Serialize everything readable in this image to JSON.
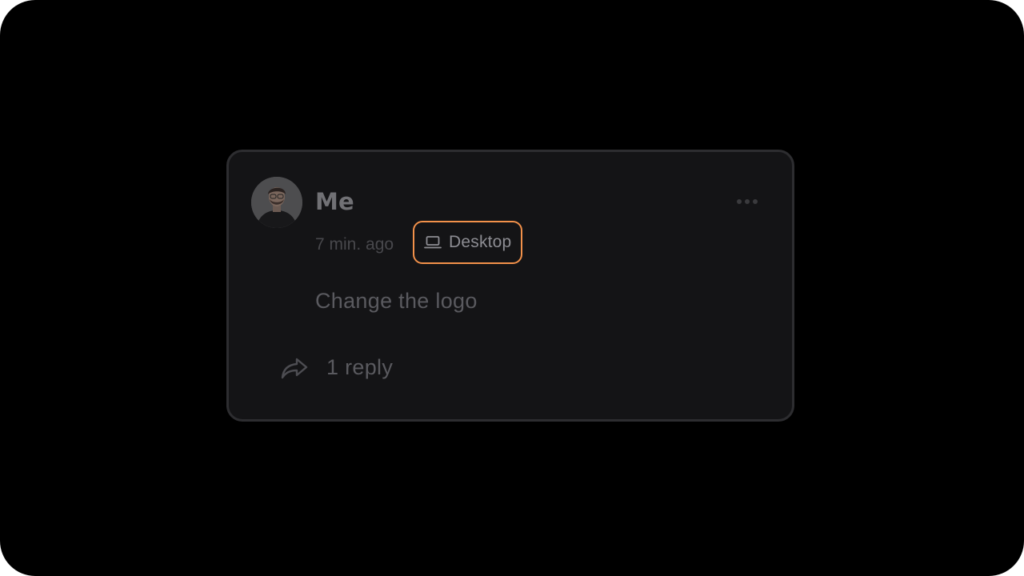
{
  "comment": {
    "author": "Me",
    "avatar_icon": "user-avatar",
    "timestamp": "7 min. ago",
    "device": {
      "icon": "laptop-icon",
      "label": "Desktop"
    },
    "body": "Change the logo",
    "replies": {
      "icon": "reply-arrow-icon",
      "label": "1 reply"
    },
    "menu_icon": "more-horizontal-icon"
  },
  "colors": {
    "background": "#000000",
    "card": "#141416",
    "card_border": "#2d2d30",
    "highlight": "#f2914a"
  }
}
